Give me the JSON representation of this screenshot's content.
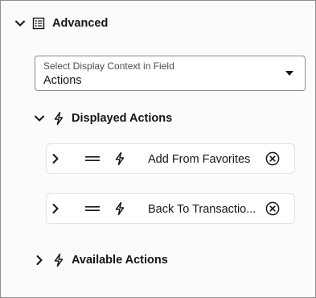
{
  "advanced": {
    "title": "Advanced",
    "chevron_icon": "chevron-down-icon",
    "section_icon": "list-form-icon"
  },
  "display_context": {
    "label": "Select Display Context in Field",
    "value": "Actions"
  },
  "displayed_actions": {
    "title": "Displayed Actions",
    "icon": "lightning-bolt-icon",
    "items": [
      {
        "label": "Add From Favorites"
      },
      {
        "label": "Back To Transactio..."
      }
    ]
  },
  "available_actions": {
    "title": "Available Actions",
    "icon": "lightning-bolt-icon"
  },
  "colors": {
    "text": "#161513",
    "border": "#8c8984",
    "background": "#fcfbfa"
  }
}
